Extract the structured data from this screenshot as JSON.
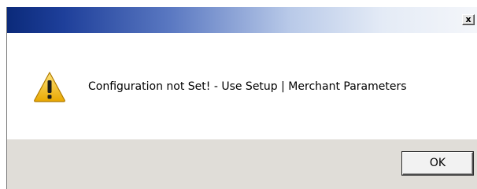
{
  "titlebar": {
    "title": "",
    "close_label": "x"
  },
  "content": {
    "icon": "warning-icon",
    "message": "Configuration not Set! - Use Setup | Merchant Parameters"
  },
  "footer": {
    "ok_label": "OK"
  },
  "colors": {
    "titlebar_start": "#0b2a7a",
    "titlebar_end": "#f4f6fa",
    "footer_bg": "#e0ddd8",
    "warning_fill": "#f5c518"
  }
}
